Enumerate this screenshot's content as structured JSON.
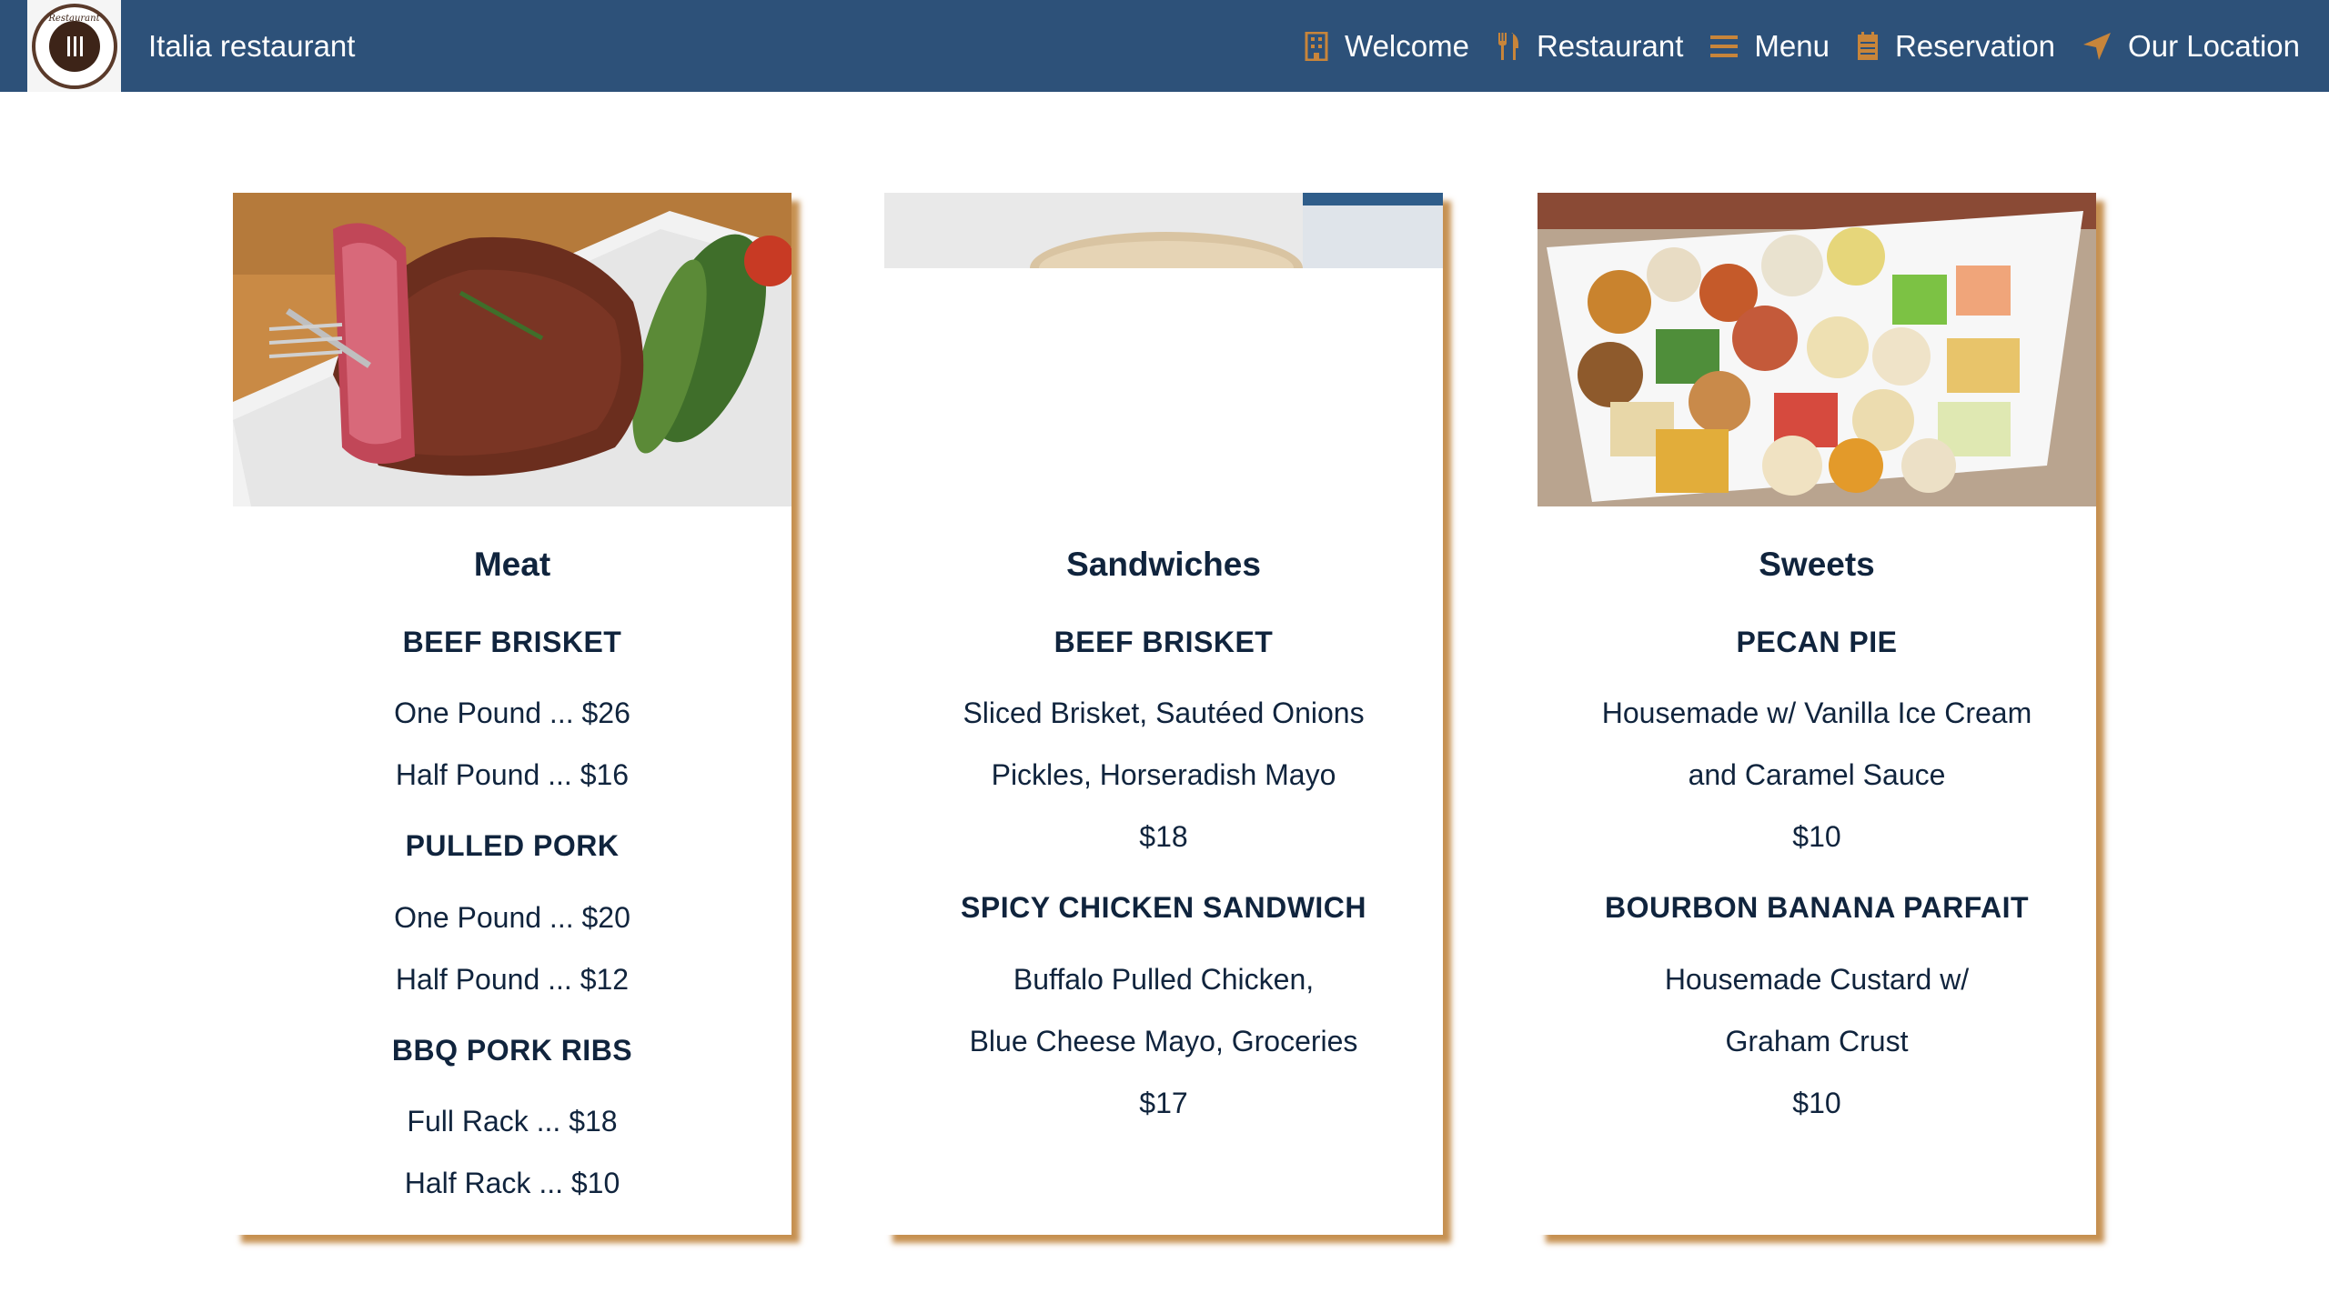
{
  "header": {
    "brand": "Italia restaurant",
    "logo_icon": "restaurant-logo",
    "nav": [
      {
        "label": "Welcome",
        "icon": "building-icon"
      },
      {
        "label": "Restaurant",
        "icon": "utensils-icon"
      },
      {
        "label": "Menu",
        "icon": "bars-icon"
      },
      {
        "label": "Reservation",
        "icon": "calendar-icon"
      },
      {
        "label": "Our Location",
        "icon": "location-arrow-icon"
      }
    ]
  },
  "colors": {
    "navbar": "#2d5179",
    "accent": "#c8853a",
    "text": "#10243d"
  },
  "cards": [
    {
      "title": "Meat",
      "image": "steak-photo",
      "sections": [
        {
          "name": "BEEF BRISKET",
          "lines": [
            "One Pound ... $26",
            "Half Pound ... $16"
          ]
        },
        {
          "name": "PULLED PORK",
          "lines": [
            "One Pound ... $20",
            "Half Pound ... $12"
          ]
        },
        {
          "name": "BBQ PORK RIBS",
          "lines": [
            "Full Rack ... $18",
            "Half Rack ... $10"
          ]
        }
      ]
    },
    {
      "title": "Sandwiches",
      "image": "sandwich-photo",
      "sections": [
        {
          "name": "BEEF BRISKET",
          "lines": [
            "Sliced Brisket, Sautéed Onions",
            "Pickles, Horseradish Mayo",
            "$18"
          ]
        },
        {
          "name": "SPICY CHICKEN SANDWICH",
          "lines": [
            "Buffalo Pulled Chicken,",
            "Blue Cheese Mayo, Groceries",
            "$17"
          ]
        }
      ]
    },
    {
      "title": "Sweets",
      "image": "sweets-photo",
      "sections": [
        {
          "name": "PECAN PIE",
          "lines": [
            "Housemade w/ Vanilla Ice Cream",
            "and Caramel Sauce",
            "$10"
          ]
        },
        {
          "name": "BOURBON BANANA PARFAIT",
          "lines": [
            "Housemade Custard w/",
            "Graham Crust",
            "$10"
          ]
        }
      ]
    }
  ]
}
